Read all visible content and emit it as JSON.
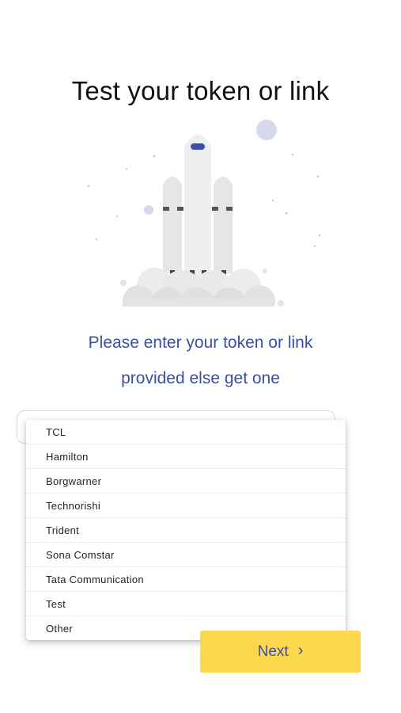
{
  "header": {
    "title": "Test your token or link"
  },
  "instructions": {
    "line1": "Please enter your token or link",
    "line2": "provided else get one"
  },
  "token_field": {
    "value": ""
  },
  "dropdown": {
    "options": [
      "TCL",
      "Hamilton",
      "Borgwarner",
      "Technorishi",
      "Trident",
      "Sona Comstar",
      "Tata Communication",
      "Test",
      "Other"
    ]
  },
  "footer": {
    "next_label": "Next",
    "next_icon": "chevron-right-icon"
  },
  "colors": {
    "accent_text": "#3a4fa8",
    "button_bg": "#fdd84e"
  },
  "illustration": {
    "icon": "rocket-launch-illustration"
  }
}
